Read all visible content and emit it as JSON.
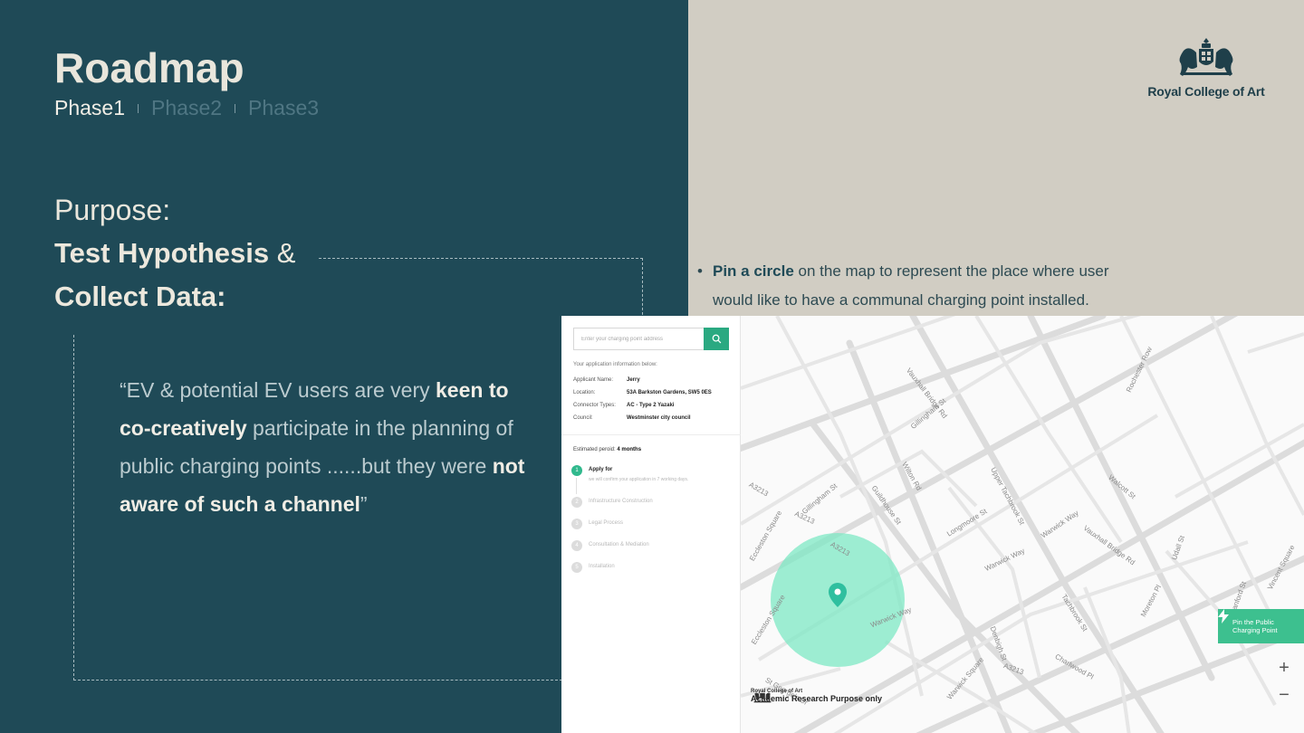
{
  "slide": {
    "title": "Roadmap",
    "phases": [
      "Phase1",
      "Phase2",
      "Phase3"
    ],
    "active_phase": "Phase1",
    "purpose_label": "Purpose:",
    "hypothesis_bold": "Test Hypothesis",
    "hypothesis_amp": "&",
    "collect": "Collect Data:",
    "quote": {
      "open": "“EV & potential EV users are very ",
      "b1": "keen to co-creatively",
      "mid": " participate in the planning of public charging points ......but they were ",
      "b2": "not aware of such a channel",
      "close": "”"
    },
    "bullet": {
      "marker": "•",
      "bold": "Pin a circle",
      "rest": " on the map to represent the place where user would like to have a communal charging point installed."
    },
    "logo": "Royal College of Art"
  },
  "app": {
    "search_placeholder": "Enter your charging point address",
    "info_heading": "Your application information below:",
    "info": [
      {
        "k": "Applicant Name:",
        "v": "Jerry"
      },
      {
        "k": "Location:",
        "v": "53A Barkston Gardens, SW5 0ES"
      },
      {
        "k": "Connector Types:",
        "v": "AC - Type 2  Yazaki"
      },
      {
        "k": "Council:",
        "v": "Westminster city council"
      }
    ],
    "estimated_label": "Estimated peroid: ",
    "estimated_value": "4 months",
    "steps": [
      {
        "num": "1",
        "label": "Apply for",
        "note": "we will confirm your application in 7 working days."
      },
      {
        "num": "2",
        "label": "Infrastructure Construction"
      },
      {
        "num": "3",
        "label": "Legal Process"
      },
      {
        "num": "4",
        "label": "Consultation & Mediation"
      },
      {
        "num": "5",
        "label": "Installation"
      }
    ]
  },
  "map": {
    "pin_button": [
      "Pin the Public",
      "Charging Point"
    ],
    "zoom_in": "+",
    "zoom_out": "−",
    "brand_small": "Royal College of Art",
    "brand_big": "Academic Research Purpose only",
    "streets": [
      "Vauxhall Bridge Rd",
      "Vauxhall Bridge Rd",
      "A3213",
      "A3213",
      "A3213",
      "A3213",
      "Gillingham St",
      "Gillingham St",
      "Wilton Rd",
      "Warwick Way",
      "Warwick Way",
      "Warwick Way",
      "Eccleston Square",
      "Eccleston Square",
      "Guildhouse St",
      "Longmoore St",
      "Tachbrook St",
      "Charlwood Pl",
      "Denbigh St",
      "Warwick Square",
      "Upper Tachbrook St",
      "Stanford St",
      "St George's Dr",
      "Walcott St",
      "Vincent Square",
      "Rochester Row",
      "Udall St",
      "Moreton Pl"
    ]
  }
}
